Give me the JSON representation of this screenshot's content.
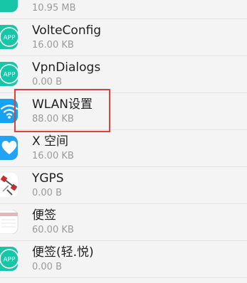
{
  "apps": [
    {
      "name": "",
      "size": "10.95 MB",
      "icon": "app-icon"
    },
    {
      "name": "VolteConfig",
      "size": "16.00 KB",
      "icon": "app-icon"
    },
    {
      "name": "VpnDialogs",
      "size": "0.00 B",
      "icon": "app-icon"
    },
    {
      "name": "WLAN设置",
      "size": "88.00 KB",
      "icon": "wifi-icon"
    },
    {
      "name": "X 空间",
      "size": "16.00 KB",
      "icon": "heart-icon"
    },
    {
      "name": "YGPS",
      "size": "0.00 B",
      "icon": "satellite-icon"
    },
    {
      "name": "便签",
      "size": "60.00 KB",
      "icon": "notes-icon"
    },
    {
      "name": "便签(轻.悦)",
      "size": "0.00 B",
      "icon": "app-icon"
    }
  ],
  "icon_label": "APP",
  "colors": {
    "app_icon": "#16c6a6",
    "wifi_icon": "#15a2f3",
    "heart_icon": "#22a2f4",
    "highlight": "#d9433f"
  }
}
